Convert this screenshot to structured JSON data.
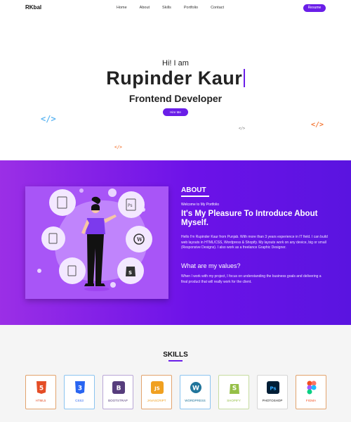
{
  "nav": {
    "brand": "RKbal",
    "items": [
      "Home",
      "About",
      "Skills",
      "Portfolio",
      "Contact"
    ],
    "resume": "Resume"
  },
  "hero": {
    "greeting": "Hi! I am",
    "name": "Rupinder Kaur",
    "role": "Frontend Developer",
    "hire": "Hire Me",
    "code_tag": "</>"
  },
  "about": {
    "title": "ABOUT",
    "subtitle": "Welcome to My Portfolio",
    "heading": "It's My Pleasure To Introduce About Myself.",
    "para1": "Hello I'm Rupinder Kaur from Punjab. With more than 3 years experience in IT field. I can build web layouts in HTML/CSS, Wordpress & Shopify. My layouts work on any device, big or small (Responsive Designs). I also work as a freelance Graphic Designer.",
    "values_title": "What are my values?",
    "para2": "When I work with my project, I focus on understanding the business goals and delivering a final product that will really work for the client."
  },
  "skills": {
    "title": "SKILLS",
    "items": [
      {
        "label": "HTML5",
        "icon": "html5-icon",
        "glyph": "5",
        "color": "#e44d26"
      },
      {
        "label": "CSS3",
        "icon": "css3-icon",
        "glyph": "3",
        "color": "#2965f1"
      },
      {
        "label": "BOOTSTRAP",
        "icon": "bootstrap-icon",
        "glyph": "B",
        "color": "#563d7c"
      },
      {
        "label": "JAVASCRIPT",
        "icon": "javascript-icon",
        "glyph": "JS",
        "color": "#f0a020"
      },
      {
        "label": "WORDPRESS",
        "icon": "wordpress-icon",
        "glyph": "W",
        "color": "#21759b"
      },
      {
        "label": "SHOPIFY",
        "icon": "shopify-icon",
        "glyph": "S",
        "color": "#95bf47"
      },
      {
        "label": "PHOTOSHOP",
        "icon": "photoshop-icon",
        "glyph": "Ps",
        "color": "#001e36"
      },
      {
        "label": "FIGMA",
        "icon": "figma-icon",
        "glyph": "",
        "color": "#f24e1e"
      }
    ]
  }
}
